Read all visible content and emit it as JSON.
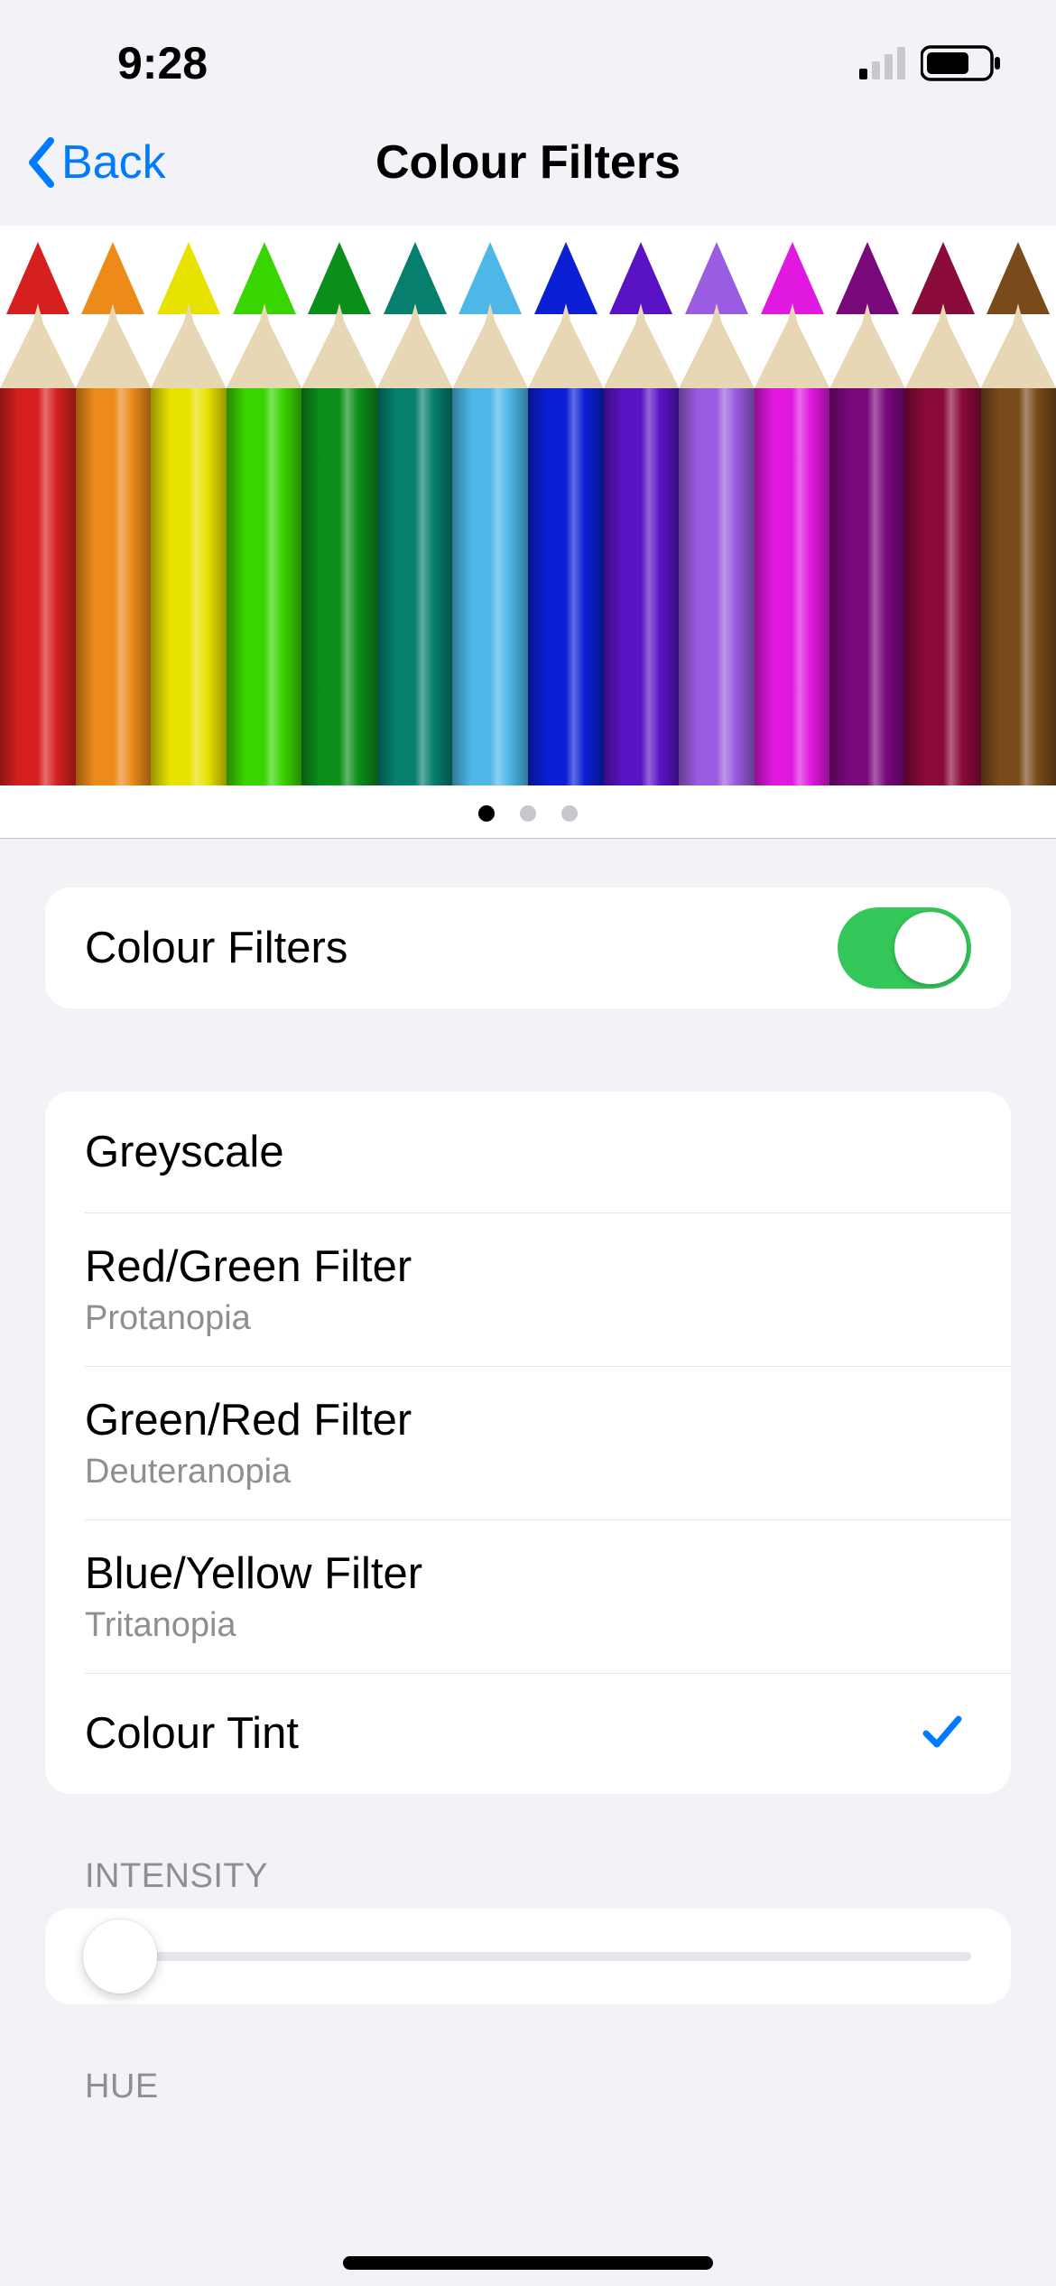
{
  "status": {
    "time": "9:28"
  },
  "nav": {
    "back": "Back",
    "title": "Colour Filters"
  },
  "preview": {
    "pencils": [
      "#d62020",
      "#ec8a1a",
      "#e7e200",
      "#39d500",
      "#0c8f1a",
      "#077f6e",
      "#4eb7e8",
      "#0b1fd4",
      "#5a13c4",
      "#9a5ce0",
      "#e018e0",
      "#79087a",
      "#8a0a3a",
      "#7a4a1a"
    ],
    "activeDot": 0,
    "dotCount": 3
  },
  "toggle": {
    "label": "Colour Filters",
    "on": true
  },
  "filters": [
    {
      "label": "Greyscale",
      "subtitle": "",
      "selected": false
    },
    {
      "label": "Red/Green Filter",
      "subtitle": "Protanopia",
      "selected": false
    },
    {
      "label": "Green/Red Filter",
      "subtitle": "Deuteranopia",
      "selected": false
    },
    {
      "label": "Blue/Yellow Filter",
      "subtitle": "Tritanopia",
      "selected": false
    },
    {
      "label": "Colour Tint",
      "subtitle": "",
      "selected": true
    }
  ],
  "intensity": {
    "header": "INTENSITY",
    "valuePct": 4
  },
  "hue": {
    "header": "HUE"
  }
}
